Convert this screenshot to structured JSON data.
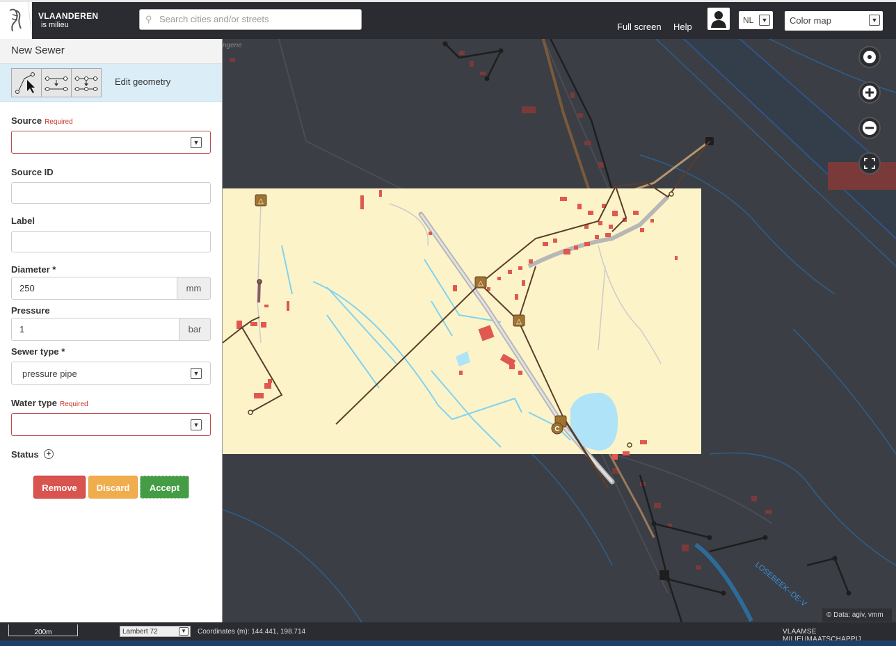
{
  "header": {
    "logo_title": "VLAANDEREN",
    "logo_subtitle": "is milieu",
    "search_placeholder": "Search cities and/or streets",
    "full_screen_label": "Full screen",
    "help_label": "Help",
    "language": "NL",
    "map_style": "Color map"
  },
  "panel": {
    "title": "New Sewer",
    "edit_geometry_label": "Edit geometry",
    "source": {
      "label": "Source",
      "required": "Required",
      "value": ""
    },
    "source_id": {
      "label": "Source ID",
      "value": ""
    },
    "label": {
      "label": "Label",
      "value": ""
    },
    "diameter": {
      "label": "Diameter *",
      "value": "250",
      "unit": "mm"
    },
    "pressure": {
      "label": "Pressure",
      "value": "1",
      "unit": "bar"
    },
    "sewer_type": {
      "label": "Sewer type *",
      "value": "pressure pipe"
    },
    "water_type": {
      "label": "Water type",
      "required": "Required",
      "value": ""
    },
    "status": {
      "label": "Status"
    },
    "buttons": {
      "remove": "Remove",
      "discard": "Discard",
      "accept": "Accept"
    }
  },
  "map": {
    "place_label": "ngene",
    "street_label": "LOSEBEEK--DE-V",
    "attribution": "Data: agiv, vmm",
    "controls": [
      "locate-icon",
      "zoom-in-icon",
      "zoom-out-icon",
      "fullscreen-icon"
    ]
  },
  "footer": {
    "scale": "200m",
    "projection": "Lambert 72",
    "coordinates": "Coordinates (m): 144.441, 198.714",
    "organisation": "VLAAMSE MILIEUMAATSCHAPPIJ"
  },
  "colors": {
    "header_bg": "#2a2c31",
    "map_dark": "#3b3e45",
    "map_highlight": "#fdf3c8",
    "building": "#e0584f",
    "water": "#7fd3f2",
    "sewer": "#5a3e2b",
    "remove_button": "#d9534f",
    "discard_button": "#f0ad4e",
    "accept_button": "#449d44"
  }
}
